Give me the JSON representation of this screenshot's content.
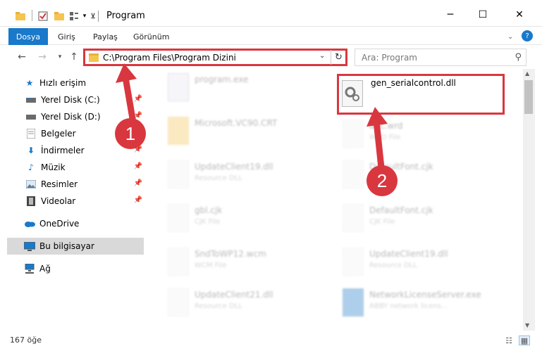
{
  "window": {
    "title": "Program",
    "minimize_icon": "minimize-icon",
    "maximize_icon": "maximize-icon",
    "close_icon": "close-icon"
  },
  "ribbon": {
    "tabs": [
      {
        "label": "Dosya"
      },
      {
        "label": "Giriş"
      },
      {
        "label": "Paylaş"
      },
      {
        "label": "Görünüm"
      }
    ]
  },
  "nav": {
    "address": "C:\\Program Files\\Program Dizini",
    "search_placeholder": "Ara: Program"
  },
  "sidebar": {
    "items": [
      {
        "label": "Hızlı erişim",
        "icon": "star-icon"
      },
      {
        "label": "Yerel Disk (C:)",
        "icon": "drive-icon"
      },
      {
        "label": "Yerel Disk (D:)",
        "icon": "drive-icon"
      },
      {
        "label": "Belgeler",
        "icon": "documents-icon"
      },
      {
        "label": "İndirmeler",
        "icon": "download-icon"
      },
      {
        "label": "Müzik",
        "icon": "music-icon"
      },
      {
        "label": "Resimler",
        "icon": "pictures-icon"
      },
      {
        "label": "Videolar",
        "icon": "video-icon"
      },
      {
        "label": "OneDrive",
        "icon": "cloud-icon"
      },
      {
        "label": "Bu bilgisayar",
        "icon": "computer-icon"
      },
      {
        "label": "Ağ",
        "icon": "network-icon"
      }
    ]
  },
  "files": {
    "highlighted": {
      "name": "gen_serialcontrol.dll"
    },
    "others": [
      {
        "name": "program.exe",
        "type": ""
      },
      {
        "name": "Microsoft.VC90.CRT",
        "type": ""
      },
      {
        "name": "abc.wrd",
        "type": "WRD File"
      },
      {
        "name": "UpdateClient19.dll",
        "type": "Resource DLL"
      },
      {
        "name": "DefaultFont.cjk",
        "type": "CJK File"
      },
      {
        "name": "gbl.cjk",
        "type": "CJK File"
      },
      {
        "name": "DefaultFont.cjk",
        "type": "CJK File"
      },
      {
        "name": "SndToWP12.wcm",
        "type": "WCM File"
      },
      {
        "name": "UpdateClient19.dll",
        "type": "Resource DLL"
      },
      {
        "name": "UpdateClient21.dll",
        "type": "Resource DLL"
      },
      {
        "name": "NetworkLicenseServer.exe",
        "type": "ABBY network licens..."
      }
    ]
  },
  "status": {
    "count": "167 öğe"
  },
  "annotations": {
    "badge1": "1",
    "badge2": "2",
    "color": "#d9373f"
  }
}
